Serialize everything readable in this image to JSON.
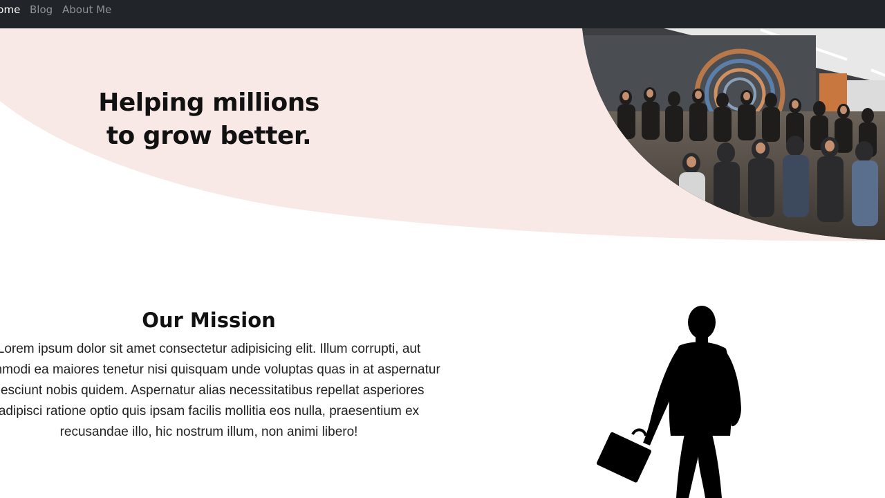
{
  "nav": {
    "links": [
      {
        "label": "Home",
        "active": true
      },
      {
        "label": "Blog",
        "active": false
      },
      {
        "label": "About Me",
        "active": false
      }
    ]
  },
  "hero": {
    "title_line1": "Helping millions",
    "title_line2": "to grow better.",
    "background_color": "#f8e9e7"
  },
  "mission": {
    "title": "Our Mission",
    "body": "Lorem ipsum dolor sit amet consectetur adipisicing elit. Illum corrupti, aut commodi ea maiores tenetur nisi quisquam unde voluptas quas in at aspernatur nesciunt nobis quidem. Aspernatur alias necessitatibus repellat asperiores adipisci ratione optio quis ipsam facilis mollitia eos nulla, praesentium ex recusandae illo, hic nostrum illum, non animi libero!"
  },
  "icons": {
    "hero_image": "audience-photo",
    "mission_image": "businessman-silhouette-icon"
  }
}
